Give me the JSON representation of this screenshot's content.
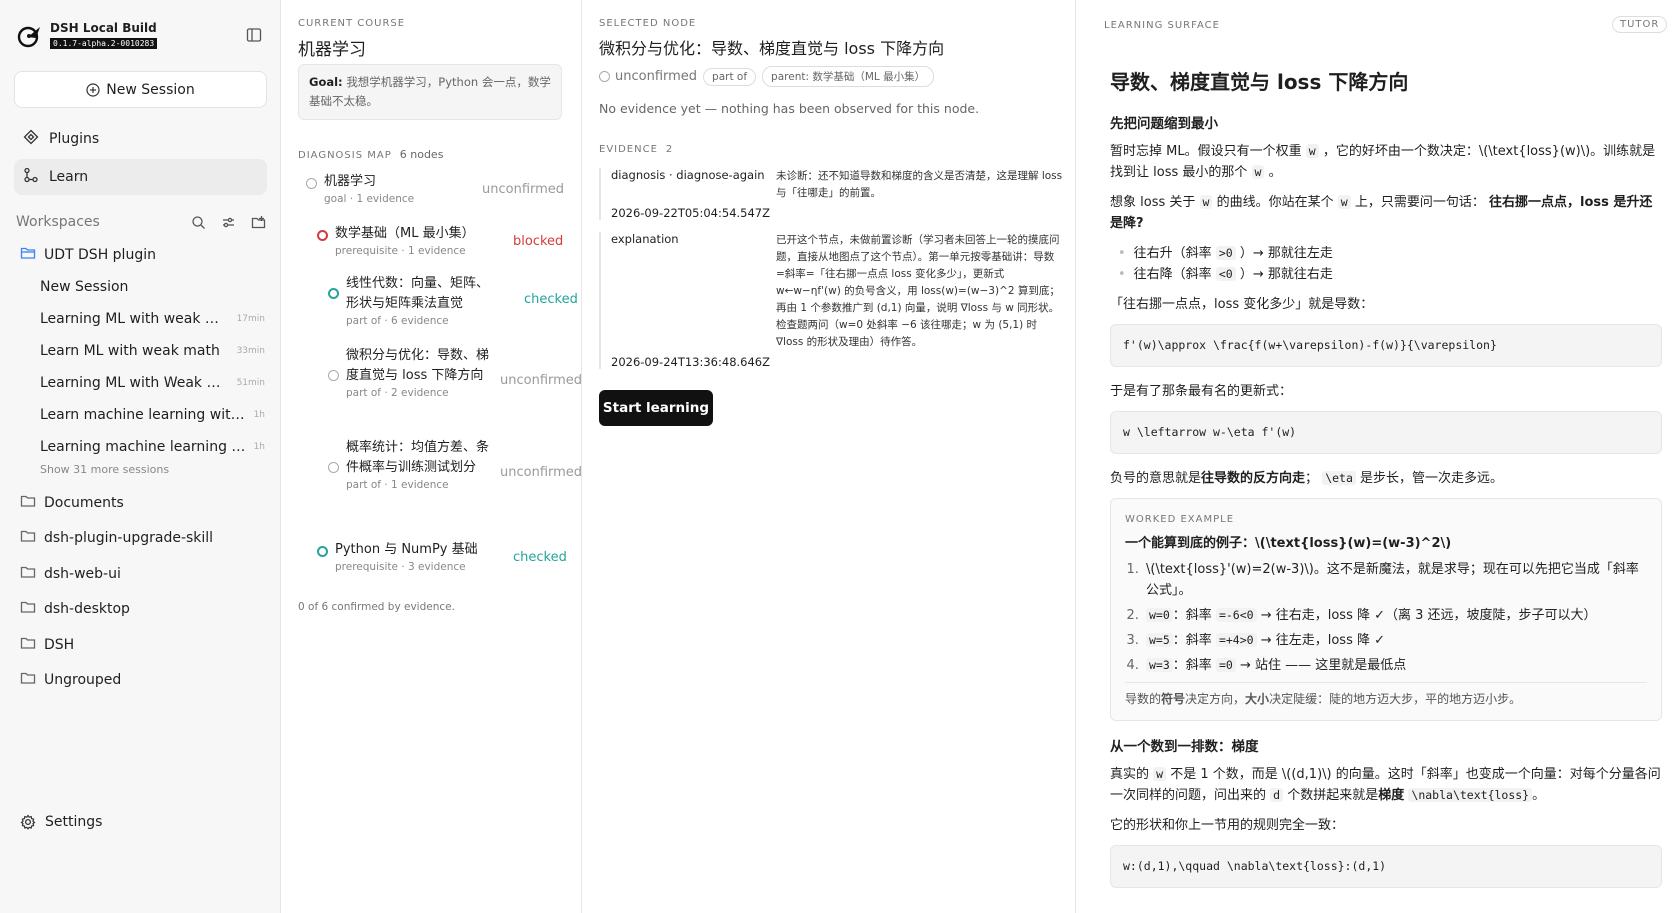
{
  "app": {
    "name": "DSH Local Build",
    "version": "0.1.7-alpha.2-0010283"
  },
  "sidebar": {
    "new_session": "New Session",
    "nav": [
      {
        "label": "Plugins",
        "icon": "plugins-icon"
      },
      {
        "label": "Learn",
        "icon": "learn-icon",
        "active": true
      }
    ],
    "workspaces_label": "Workspaces",
    "workspaces": [
      {
        "label": "UDT DSH plugin",
        "open": true,
        "sessions": [
          {
            "label": "New Session",
            "time": ""
          },
          {
            "label": "Learning ML with weak math",
            "time": "17min"
          },
          {
            "label": "Learn ML with weak math",
            "time": "33min"
          },
          {
            "label": "Learning ML with Weak Ma...",
            "time": "51min"
          },
          {
            "label": "Learn machine learning with ...",
            "time": "1h"
          },
          {
            "label": "Learning machine learning wi...",
            "time": "1h"
          }
        ],
        "show_more": "Show 31 more sessions"
      },
      {
        "label": "Documents"
      },
      {
        "label": "dsh-plugin-upgrade-skill"
      },
      {
        "label": "dsh-web-ui"
      },
      {
        "label": "dsh-desktop"
      },
      {
        "label": "DSH"
      },
      {
        "label": "Ungrouped"
      }
    ],
    "settings": "Settings"
  },
  "course": {
    "eyebrow": "CURRENT COURSE",
    "title": "机器学习",
    "goal_label": "Goal:",
    "goal_text": "我想学机器学习，Python 会一点，数学基础不太稳。",
    "map_label": "DIAGNOSIS MAP",
    "map_count": "6 nodes",
    "nodes": [
      {
        "name": "机器学习",
        "meta": "goal · 1 evidence",
        "status": "unconfirmed"
      },
      {
        "name": "数学基础（ML 最小集）",
        "meta": "prerequisite · 1 evidence",
        "status": "blocked"
      },
      {
        "name": "线性代数：向量、矩阵、形状与矩阵乘法直觉",
        "meta": "part of · 6 evidence",
        "status": "checked"
      },
      {
        "name": "微积分与优化：导数、梯度直觉与 loss 下降方向",
        "meta": "part of · 2 evidence",
        "status": "unconfirmed"
      },
      {
        "name": "概率统计：均值方差、条件概率与训练测试划分",
        "meta": "part of · 1 evidence",
        "status": "unconfirmed"
      },
      {
        "name": "Python 与 NumPy 基础",
        "meta": "prerequisite · 3 evidence",
        "status": "checked"
      }
    ],
    "confirmed_summary": "0 of 6 confirmed by evidence."
  },
  "node": {
    "eyebrow": "SELECTED NODE",
    "title": "微积分与优化：导数、梯度直觉与 loss 下降方向",
    "status": "unconfirmed",
    "relation": "part of",
    "parent": "parent: 数学基础（ML 最小集）",
    "no_evidence": "No evidence yet — nothing has been observed for this node.",
    "evidence_label": "EVIDENCE",
    "evidence_count": "2",
    "evidence": [
      {
        "kind": "diagnosis · diagnose-again",
        "text": "未诊断：还不知道导数和梯度的含义是否清楚，这是理解 loss 与「往哪走」的前置。",
        "time": "2026-09-22T05:04:54.547Z"
      },
      {
        "kind": "explanation",
        "text": "已开这个节点，未做前置诊断（学习者未回答上一轮的摸底问题，直接从地图点了这个节点）。第一单元按零基础讲：导数=斜率=「往右挪一点点 loss 变化多少」，更新式 w←w−ηf'(w) 的负号含义，用 loss(w)=(w−3)^2 算到底；再由 1 个参数推广到 (d,1) 向量，说明 ∇loss 与 w 同形状。检查题两问（w=0 处斜率 −6 该往哪走；w 为 (5,1) 时 ∇loss 的形状及理由）待作答。",
        "time": "2026-09-24T13:36:48.646Z"
      }
    ],
    "start_button": "Start learning"
  },
  "surface": {
    "eyebrow": "LEARNING SURFACE",
    "badge": "TUTOR",
    "title": "导数、梯度直觉与 loss 下降方向",
    "s1_heading": "先把问题缩到最小",
    "p1_a": "暂时忘掉 ML。假设只有一个权重",
    "p1_code1": "w",
    "p1_b": "，它的好坏由一个数决定：\\(\\text{loss}(w)\\)。训练就是找到让 loss 最小的那个",
    "p1_code2": "w",
    "p1_c": "。",
    "p2_a": "想象 loss 关于",
    "p2_code1": "w",
    "p2_b": "的曲线。你站在某个",
    "p2_code2": "w",
    "p2_c": "上，只需要问一句话：",
    "p2_bold": "往右挪一点点，loss 是升还是降?",
    "bullet1_a": "往右升（斜率",
    "bullet1_code": ">0",
    "bullet1_b": "）→ 那就往左走",
    "bullet2_a": "往右降（斜率",
    "bullet2_code": "<0",
    "bullet2_b": "）→ 那就往右走",
    "p3": "「往右挪一点点，loss 变化多少」就是导数：",
    "code1": "f'(w)\\approx \\frac{f(w+\\varepsilon)-f(w)}{\\varepsilon}",
    "p4": "于是有了那条最有名的更新式：",
    "code2": "w \\leftarrow w-\\eta f'(w)",
    "p5_a": "负号的意思就是",
    "p5_bold": "往导数的反方向走",
    "p5_b": "；",
    "p5_code": "\\eta",
    "p5_c": "是步长，管一次走多远。",
    "example": {
      "label": "WORKED EXAMPLE",
      "title": "一个能算到底的例子：\\(\\text{loss}(w)=(w-3)^2\\)",
      "step1": "\\(\\text{loss}'(w)=2(w-3)\\)。这不是新魔法，就是求导；现在可以先把它当成「斜率公式」。",
      "step2_code": "w=0",
      "step2_a": "：斜率",
      "step2_code2": "=-6<0",
      "step2_b": "→ 往右走，loss 降 ✓（离 3 还远，坡度陡，步子可以大）",
      "step3_code": "w=5",
      "step3_a": "：斜率",
      "step3_code2": "=+4>0",
      "step3_b": "→ 往左走，loss 降 ✓",
      "step4_code": "w=3",
      "step4_a": "：斜率",
      "step4_code2": "=0",
      "step4_b": "→ 站住 —— 这里就是最低点",
      "foot_a": "导数的",
      "foot_b1": "符号",
      "foot_c": "决定方向，",
      "foot_b2": "大小",
      "foot_d": "决定陡缓：陡的地方迈大步，平的地方迈小步。"
    },
    "s2_heading": "从一个数到一排数：梯度",
    "p6_a": "真实的",
    "p6_code1": "w",
    "p6_b": "不是 1 个数，而是 \\((d,1)\\) 的向量。这时「斜率」也变成一个向量：对每个分量各问一次同样的问题，问出来的",
    "p6_code2": "d",
    "p6_c": "个数拼起来就是",
    "p6_bold": "梯度",
    "p6_code3": "\\nabla\\text{loss}",
    "p6_d": "。",
    "p7": "它的形状和你上一节用的规则完全一致：",
    "code3": "w:(d,1),\\qquad \\nabla\\text{loss}:(d,1)"
  }
}
